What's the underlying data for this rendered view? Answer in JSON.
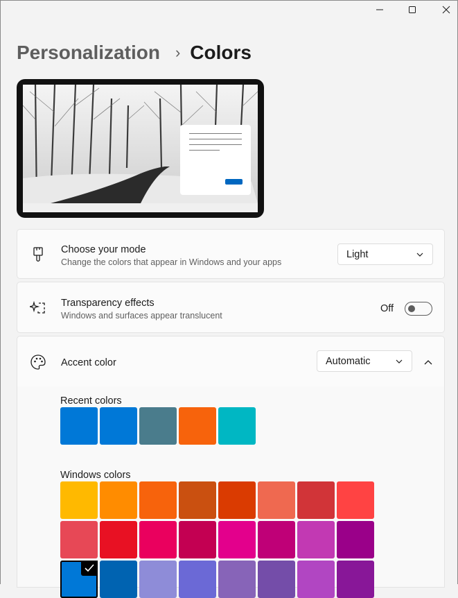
{
  "window": {
    "controls": {
      "minimize": "minimize-icon",
      "maximize": "maximize-icon",
      "close": "close-icon"
    }
  },
  "breadcrumb": {
    "parent": "Personalization",
    "separator": "›",
    "current": "Colors"
  },
  "preview": {
    "accent_button_color": "#0067c0"
  },
  "mode": {
    "title": "Choose your mode",
    "description": "Change the colors that appear in Windows and your apps",
    "value": "Light",
    "icon": "brush-icon"
  },
  "transparency": {
    "title": "Transparency effects",
    "description": "Windows and surfaces appear translucent",
    "state_label": "Off",
    "enabled": false,
    "icon": "sparkle-icon"
  },
  "accent": {
    "title": "Accent color",
    "value": "Automatic",
    "icon": "palette-icon",
    "recent_label": "Recent colors",
    "recent_colors": [
      "#0078d7",
      "#0078d7",
      "#4a7c8c",
      "#f7630c",
      "#00b7c3"
    ],
    "windows_label": "Windows colors",
    "windows_colors": [
      [
        "#ffb900",
        "#ff8c00",
        "#f7630c",
        "#ca5010",
        "#da3b01",
        "#ef6950",
        "#d13438",
        "#ff4343"
      ],
      [
        "#e74856",
        "#e81123",
        "#ea005e",
        "#c30052",
        "#e3008c",
        "#bf0077",
        "#c239b3",
        "#9a0089"
      ],
      [
        "#0078d7",
        "#0063b1",
        "#8e8cd8",
        "#6b69d6",
        "#8764b8",
        "#744da9",
        "#b146c2",
        "#881798"
      ]
    ],
    "selected_row": 2,
    "selected_col": 0
  }
}
